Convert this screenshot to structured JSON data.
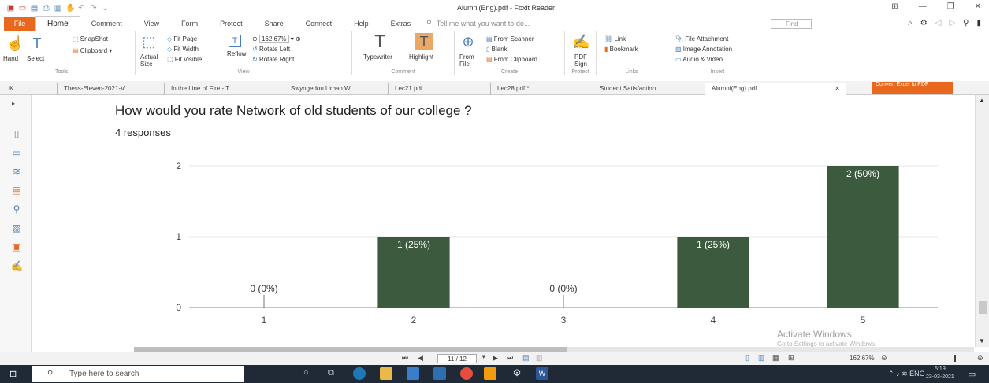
{
  "window": {
    "title": "Alumni(Eng).pdf - Foxit Reader"
  },
  "menu": {
    "file": "File",
    "tabs": [
      "Home",
      "Comment",
      "View",
      "Form",
      "Protect",
      "Share",
      "Connect",
      "Help",
      "Extras"
    ],
    "tell_me": "Tell me what you want to do...",
    "find_placeholder": "Find"
  },
  "ribbon": {
    "tools": {
      "hand": "Hand",
      "select": "Select",
      "snapshot": "SnapShot",
      "clipboard": "Clipboard",
      "label": "Tools"
    },
    "view": {
      "actual_size": "Actual Size",
      "fit_page": "Fit Page",
      "fit_width": "Fit Width",
      "fit_visible": "Fit Visible",
      "reflow": "Reflow",
      "zoom": "162.67%",
      "rotate_left": "Rotate Left",
      "rotate_right": "Rotate Right",
      "label": "View"
    },
    "comment": {
      "typewriter": "Typewriter",
      "highlight": "Highlight",
      "label": "Comment"
    },
    "create": {
      "from_file": "From File",
      "from_scanner": "From Scanner",
      "blank": "Blank",
      "from_clipboard": "From Clipboard",
      "label": "Create"
    },
    "protect": {
      "pdf_sign": "PDF Sign",
      "label": "Protect"
    },
    "links": {
      "link": "Link",
      "bookmark": "Bookmark",
      "label": "Links"
    },
    "insert": {
      "file_attachment": "File Attachment",
      "image_annotation": "Image Annotation",
      "audio_video": "Audio & Video",
      "label": "Insert"
    }
  },
  "doc_tabs": [
    "K...",
    "Thess-Eleven-2021-V...",
    "In the Line of Fire - T...",
    "Swyngedou Urban W...",
    "Lec21.pdf",
    "Lec28.pdf *",
    "Student Satisfaction ...",
    "Alumni(Eng).pdf"
  ],
  "convert_banner": "Convert Excel to PDF",
  "question": {
    "title": "How would you rate Network of old students of our college ?",
    "responses": "4 responses"
  },
  "chart_data": {
    "type": "bar",
    "categories": [
      "1",
      "2",
      "3",
      "4",
      "5"
    ],
    "values": [
      0,
      1,
      0,
      1,
      2
    ],
    "data_labels": [
      "0 (0%)",
      "1 (25%)",
      "0 (0%)",
      "1 (25%)",
      "2 (50%)"
    ],
    "yticks": [
      0,
      1,
      2
    ],
    "ylim": [
      0,
      2
    ],
    "bar_color": "#3b5a3e",
    "grid": true,
    "title": "",
    "xlabel": "",
    "ylabel": ""
  },
  "status": {
    "page": "11 / 12",
    "zoom": "162.67%"
  },
  "watermark": {
    "line1": "Activate Windows",
    "line2": "Go to Settings to activate Windows."
  },
  "taskbar": {
    "search_placeholder": "Type here to search",
    "lang": "ENG",
    "time": "5:19",
    "date": "23-03-2021"
  }
}
